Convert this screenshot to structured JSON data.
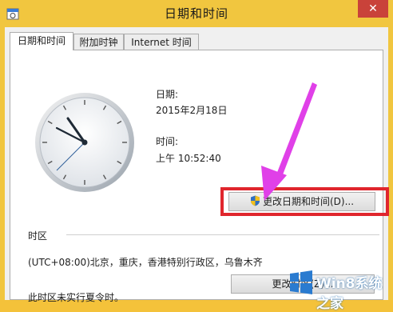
{
  "window": {
    "title": "日期和时间",
    "close_glyph": "✕"
  },
  "tabs": [
    "日期和时间",
    "附加时钟",
    "Internet 时间"
  ],
  "date": {
    "label": "日期:",
    "value": "2015年2月18日"
  },
  "time": {
    "label": "时间:",
    "value": "上午 10:52:40"
  },
  "buttons": {
    "change_datetime": "更改日期和时间(D)...",
    "change_timezone": "更改时区(Z)..."
  },
  "timezone": {
    "heading": "时区",
    "value": "(UTC+08:00)北京，重庆，香港特别行政区，乌鲁木齐"
  },
  "dst_note": "此时区未实行夏令时。",
  "watermark": {
    "text": "Win8系统之家"
  },
  "colors": {
    "highlight": "#e0262d",
    "arrow": "#e040e8",
    "frame": "#f1c63f",
    "close": "#c9423a"
  },
  "icons": [
    "calendar-clock-icon",
    "close-icon",
    "analog-clock-icon",
    "uac-shield-icon",
    "windows-logo-icon"
  ]
}
